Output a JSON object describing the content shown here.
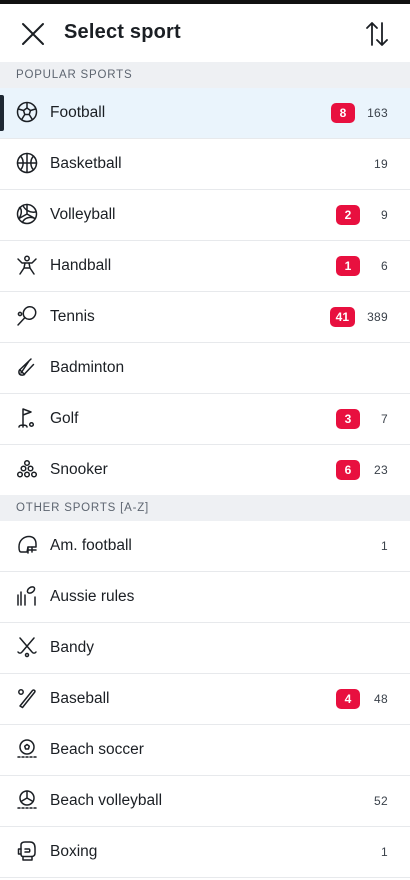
{
  "header": {
    "title": "Select sport"
  },
  "sections": {
    "popular": "POPULAR SPORTS",
    "other": "OTHER SPORTS [A-Z]"
  },
  "popular": [
    {
      "name": "Football",
      "badge": "8",
      "count": "163",
      "icon": "football-icon",
      "selected": true
    },
    {
      "name": "Basketball",
      "badge": "",
      "count": "19",
      "icon": "basketball-icon"
    },
    {
      "name": "Volleyball",
      "badge": "2",
      "count": "9",
      "icon": "volleyball-icon"
    },
    {
      "name": "Handball",
      "badge": "1",
      "count": "6",
      "icon": "handball-icon"
    },
    {
      "name": "Tennis",
      "badge": "41",
      "count": "389",
      "icon": "tennis-icon"
    },
    {
      "name": "Badminton",
      "badge": "",
      "count": "",
      "icon": "badminton-icon"
    },
    {
      "name": "Golf",
      "badge": "3",
      "count": "7",
      "icon": "golf-icon"
    },
    {
      "name": "Snooker",
      "badge": "6",
      "count": "23",
      "icon": "snooker-icon"
    }
  ],
  "other": [
    {
      "name": "Am. football",
      "badge": "",
      "count": "1",
      "icon": "american-football-icon"
    },
    {
      "name": "Aussie rules",
      "badge": "",
      "count": "",
      "icon": "aussie-rules-icon"
    },
    {
      "name": "Bandy",
      "badge": "",
      "count": "",
      "icon": "bandy-icon"
    },
    {
      "name": "Baseball",
      "badge": "4",
      "count": "48",
      "icon": "baseball-icon"
    },
    {
      "name": "Beach soccer",
      "badge": "",
      "count": "",
      "icon": "beach-soccer-icon"
    },
    {
      "name": "Beach volleyball",
      "badge": "",
      "count": "52",
      "icon": "beach-volleyball-icon"
    },
    {
      "name": "Boxing",
      "badge": "",
      "count": "1",
      "icon": "boxing-icon"
    }
  ],
  "colors": {
    "badge": "#e8103f",
    "selected_bg": "#eaf4fc",
    "section_bg": "#eef0f3"
  }
}
